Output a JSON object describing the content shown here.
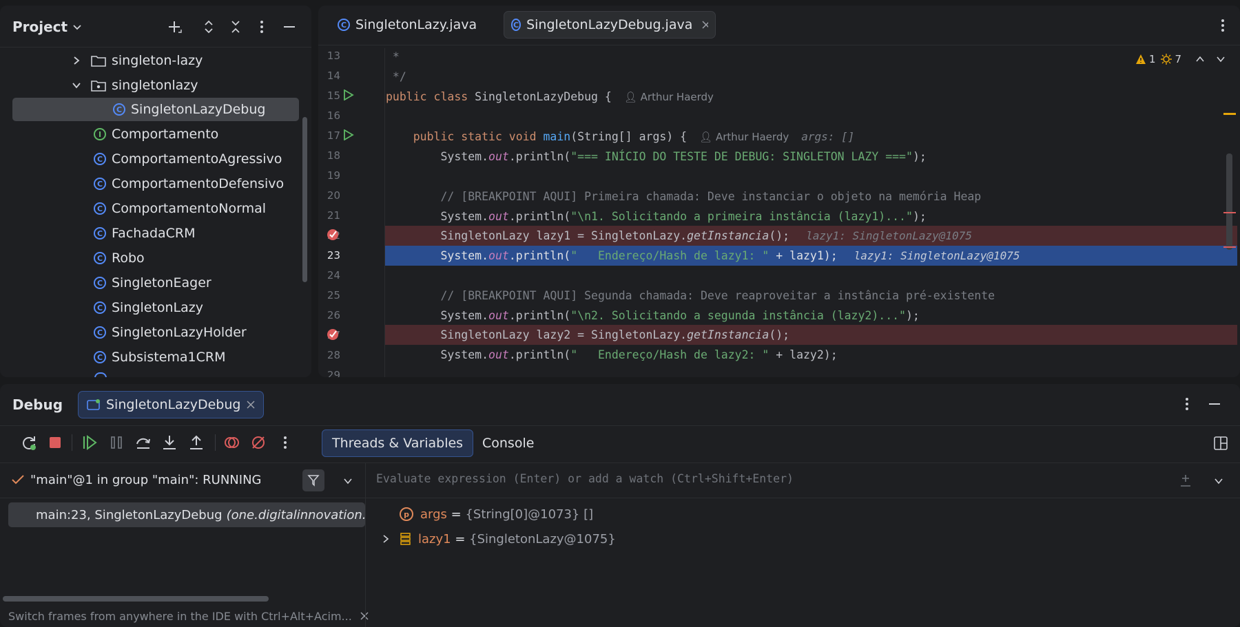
{
  "project": {
    "title": "Project",
    "items": [
      {
        "label": "singleton-lazy",
        "kind": "folder-collapsed"
      },
      {
        "label": "singletonlazy",
        "kind": "folder-expanded"
      },
      {
        "label": "SingletonLazyDebug",
        "kind": "class-main"
      },
      {
        "label": "Comportamento",
        "kind": "interface"
      },
      {
        "label": "ComportamentoAgressivo",
        "kind": "class"
      },
      {
        "label": "ComportamentoDefensivo",
        "kind": "class"
      },
      {
        "label": "ComportamentoNormal",
        "kind": "class"
      },
      {
        "label": "FachadaCRM",
        "kind": "class"
      },
      {
        "label": "Robo",
        "kind": "class"
      },
      {
        "label": "SingletonEager",
        "kind": "class"
      },
      {
        "label": "SingletonLazy",
        "kind": "class"
      },
      {
        "label": "SingletonLazyHolder",
        "kind": "class"
      },
      {
        "label": "Subsistema1CRM",
        "kind": "class"
      }
    ]
  },
  "editor": {
    "tabs": [
      {
        "label": "SingletonLazy.java",
        "active": false
      },
      {
        "label": "SingletonLazyDebug.java",
        "active": true
      }
    ],
    "warnings": "1",
    "weak_warnings": "7",
    "line_numbers": [
      "13",
      "14",
      "15",
      "16",
      "17",
      "18",
      "19",
      "20",
      "21",
      "22",
      "23",
      "24",
      "25",
      "26",
      "27",
      "28",
      "29"
    ],
    "lines": {
      "l13": " *",
      "l14": " */",
      "l15_a": "public class ",
      "l15_b": "SingletonLazyDebug {",
      "l15_author": "Arthur Haerdy",
      "l17_a": "    public static void ",
      "l17_b": "main",
      "l17_c": "(String[] args) {",
      "l17_author": "Arthur Haerdy",
      "l17_hint": "args: []",
      "l18_a": "        System.",
      "l18_b": "out",
      "l18_c": ".println(",
      "l18_d": "\"=== INÍCIO DO TESTE DE DEBUG: SINGLETON LAZY ===\"",
      "l18_e": ");",
      "l20": "        // [BREAKPOINT AQUI] Primeira chamada: Deve instanciar o objeto na memória Heap",
      "l21_a": "        System.",
      "l21_b": "out",
      "l21_c": ".println(",
      "l21_d": "\"\\n1. Solicitando a primeira instância (lazy1)...\"",
      "l21_e": ");",
      "l22_a": "        SingletonLazy lazy1 = SingletonLazy.",
      "l22_b": "getInstancia",
      "l22_c": "();",
      "l22_hint": "lazy1: SingletonLazy@1075",
      "l23_a": "        System.",
      "l23_b": "out",
      "l23_c": ".println(",
      "l23_d": "\"   Endereço/Hash de lazy1: \"",
      "l23_e": " + lazy1);",
      "l23_hint": "lazy1: SingletonLazy@1075",
      "l25": "        // [BREAKPOINT AQUI] Segunda chamada: Deve reaproveitar a instância pré-existente",
      "l26_a": "        System.",
      "l26_b": "out",
      "l26_c": ".println(",
      "l26_d": "\"\\n2. Solicitando a segunda instância (lazy2)...\"",
      "l26_e": ");",
      "l27_a": "        SingletonLazy lazy2 = SingletonLazy.",
      "l27_b": "getInstancia",
      "l27_c": "();",
      "l28_a": "        System.",
      "l28_b": "out",
      "l28_c": ".println(",
      "l28_d": "\"   Endereço/Hash de lazy2: \"",
      "l28_e": " + lazy2);"
    }
  },
  "debug": {
    "title": "Debug",
    "session_tab": "SingletonLazyDebug",
    "tabs": [
      "Threads & Variables",
      "Console"
    ],
    "thread_status": "\"main\"@1 in group \"main\": RUNNING",
    "frame_a": "main:23, SingletonLazyDebug ",
    "frame_b": "(one.digitalinnovation.",
    "eval_placeholder": "Evaluate expression (Enter) or add a watch (Ctrl+Shift+Enter)",
    "variables": [
      {
        "name": "args",
        "eq": " = ",
        "value": "{String[0]@1073} []"
      },
      {
        "name": "lazy1",
        "eq": " = ",
        "value": "{SingletonLazy@1075}"
      }
    ],
    "hint": "Switch frames from anywhere in the IDE with Ctrl+Alt+Acim..."
  },
  "colors": {
    "accent": "#548af7",
    "breakpoint_line": "#4b2a2e",
    "execution_line": "#2a4d8f",
    "warning": "#e5a50a"
  }
}
